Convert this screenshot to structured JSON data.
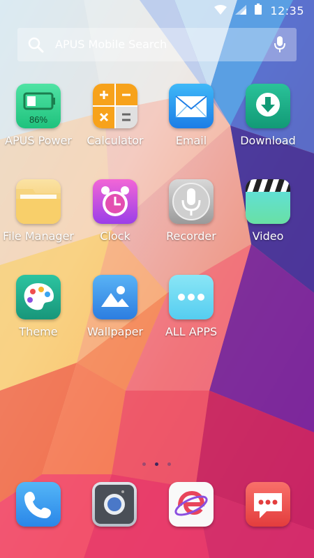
{
  "status": {
    "time": "12:35"
  },
  "search": {
    "placeholder": "APUS Mobile Search"
  },
  "apps": [
    {
      "label": "APUS Power",
      "battery": "86%"
    },
    {
      "label": "Calculator"
    },
    {
      "label": "Email"
    },
    {
      "label": "Download"
    },
    {
      "label": "File Manager"
    },
    {
      "label": "Clock"
    },
    {
      "label": "Recorder"
    },
    {
      "label": "Video"
    },
    {
      "label": "Theme"
    },
    {
      "label": "Wallpaper"
    },
    {
      "label": "ALL APPS"
    }
  ],
  "pager": {
    "count": 3,
    "active": 2
  },
  "dock": [
    {
      "name": "phone",
      "icon": "phone-icon"
    },
    {
      "name": "camera",
      "icon": "camera-icon"
    },
    {
      "name": "browser",
      "icon": "browser-icon"
    },
    {
      "name": "messages",
      "icon": "message-icon"
    }
  ]
}
